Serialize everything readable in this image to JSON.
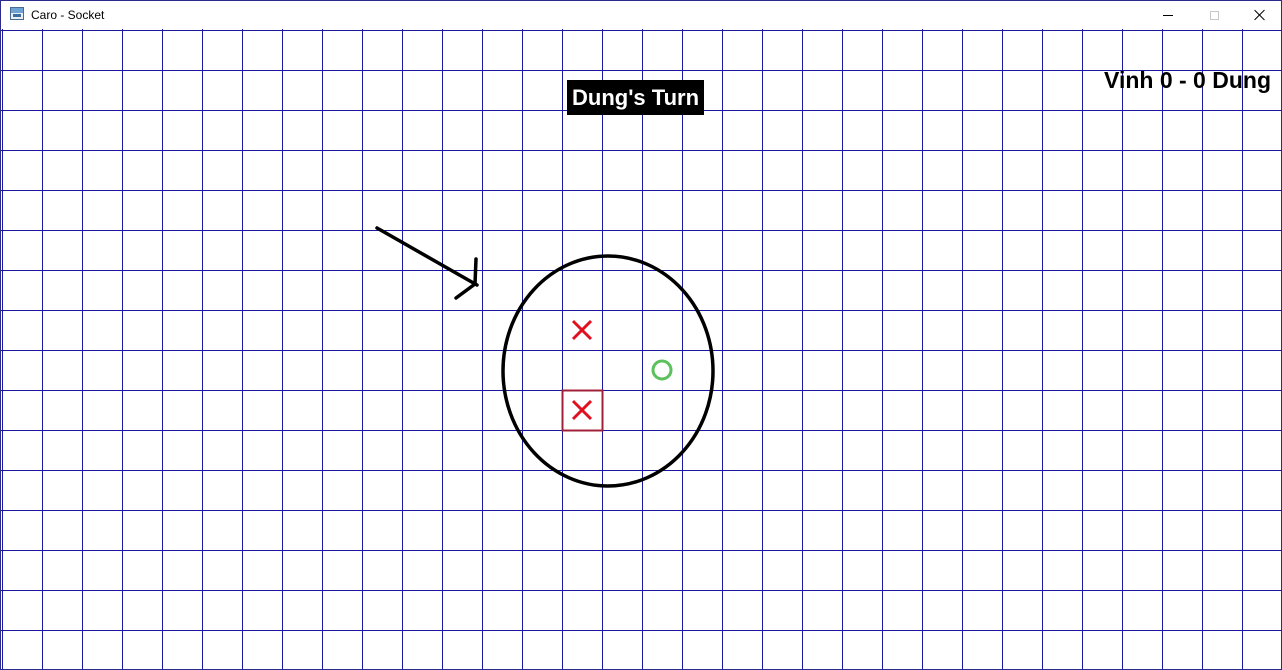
{
  "window": {
    "title": "Caro - Socket",
    "icon": "app-window-icon",
    "controls": [
      "minimize-icon",
      "maximize-icon",
      "close-icon"
    ]
  },
  "game": {
    "turn_text": "Dung's Turn",
    "score_text": "Vinh 0 - 0 Dung",
    "grid_color": "#1a1aa0",
    "x_color": "#e01020",
    "o_color": "#5cc05c",
    "last_move_box_color": "#a0203a",
    "moves": [
      {
        "mark": "X",
        "col": 14,
        "row": 7,
        "last": false
      },
      {
        "mark": "X",
        "col": 14,
        "row": 9,
        "last": true
      },
      {
        "mark": "O",
        "col": 16,
        "row": 8,
        "last": false
      }
    ],
    "annotations": [
      "arrow",
      "circle"
    ]
  }
}
